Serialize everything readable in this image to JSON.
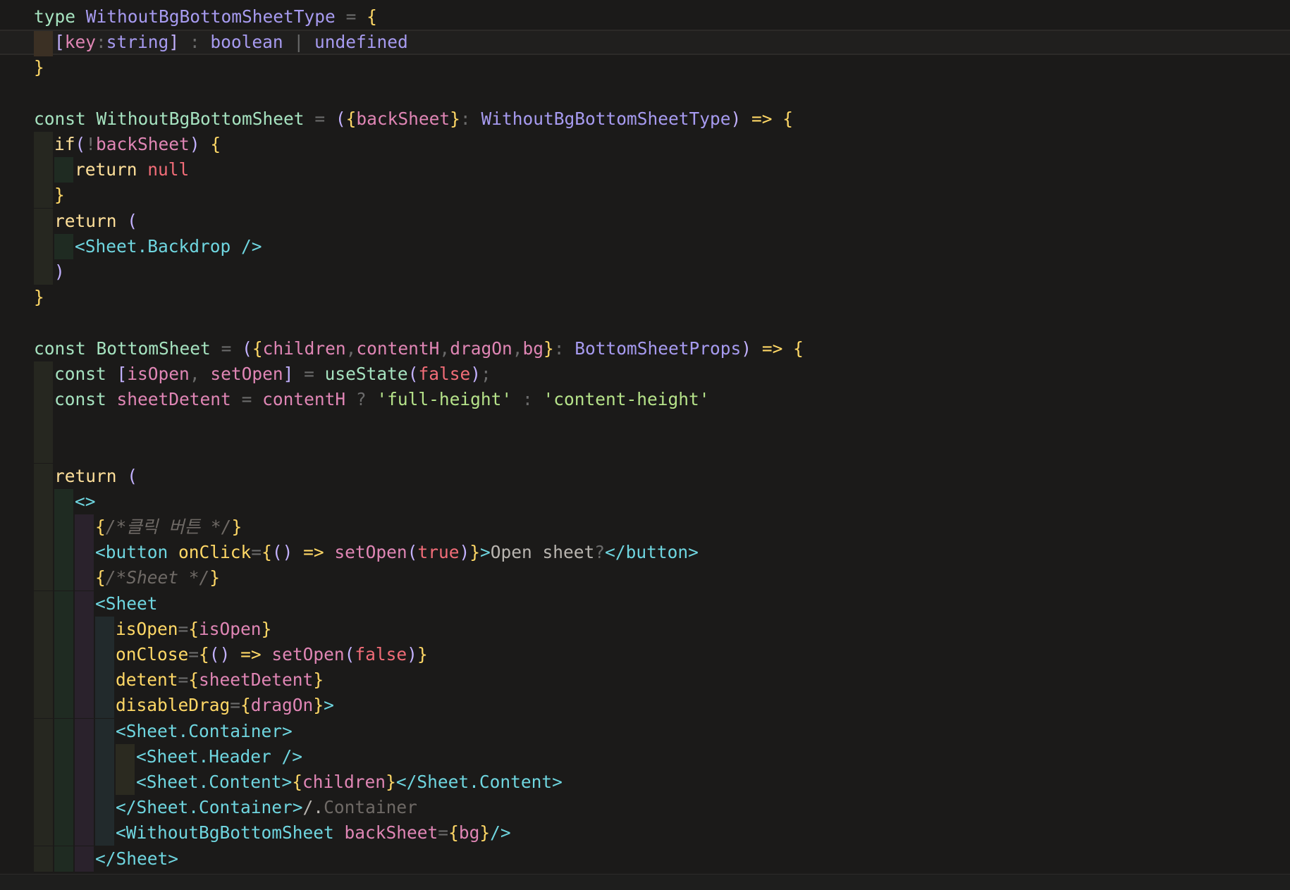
{
  "editor": {
    "lines": [
      {
        "indent": 0,
        "text": "type WithoutBgBottomSheetType = {"
      },
      {
        "indent": 1,
        "text": "[key:string] : boolean | undefined"
      },
      {
        "indent": 0,
        "text": "}"
      },
      {
        "indent": 0,
        "text": ""
      },
      {
        "indent": 0,
        "text": "const WithoutBgBottomSheet = ({backSheet}: WithoutBgBottomSheetType) => {"
      },
      {
        "indent": 1,
        "text": "if(!backSheet) {"
      },
      {
        "indent": 2,
        "text": "return null"
      },
      {
        "indent": 1,
        "text": "}"
      },
      {
        "indent": 1,
        "text": "return ("
      },
      {
        "indent": 2,
        "text": "<Sheet.Backdrop />"
      },
      {
        "indent": 1,
        "text": ")"
      },
      {
        "indent": 0,
        "text": "}"
      },
      {
        "indent": 0,
        "text": ""
      },
      {
        "indent": 0,
        "text": "const BottomSheet = ({children,contentH,dragOn,bg}: BottomSheetProps) => {"
      },
      {
        "indent": 1,
        "text": "const [isOpen, setOpen] = useState(false);"
      },
      {
        "indent": 1,
        "text": "const sheetDetent = contentH ? 'full-height' : 'content-height'"
      },
      {
        "indent": 1,
        "text": ""
      },
      {
        "indent": 1,
        "text": ""
      },
      {
        "indent": 1,
        "text": "return ("
      },
      {
        "indent": 2,
        "text": "<>"
      },
      {
        "indent": 3,
        "text": "{/*클릭 버튼 */}"
      },
      {
        "indent": 3,
        "text": "<button onClick={() => setOpen(true)}>Open sheet?</button>"
      },
      {
        "indent": 3,
        "text": "{/*Sheet */}"
      },
      {
        "indent": 3,
        "text": "<Sheet"
      },
      {
        "indent": 4,
        "text": "isOpen={isOpen}"
      },
      {
        "indent": 4,
        "text": "onClose={() => setOpen(false)}"
      },
      {
        "indent": 4,
        "text": "detent={sheetDetent}"
      },
      {
        "indent": 4,
        "text": "disableDrag={dragOn}>"
      },
      {
        "indent": 4,
        "text": "<Sheet.Container>"
      },
      {
        "indent": 5,
        "text": "<Sheet.Header />"
      },
      {
        "indent": 5,
        "text": "<Sheet.Content>{children}</Sheet.Content>"
      },
      {
        "indent": 4,
        "text": "</Sheet.Container>/.Container"
      },
      {
        "indent": 4,
        "text": "<WithoutBgBottomSheet backSheet={bg}/>"
      },
      {
        "indent": 3,
        "text": "</Sheet>"
      }
    ]
  },
  "colors": {
    "background": "#1b1a19",
    "keyword": "#a6e3c0",
    "type": "#a79bf0",
    "variable": "#e086b5",
    "string": "#b6e38a",
    "tag": "#6fd6e0",
    "attribute": "#ffd866",
    "comment": "#6f6a66",
    "null": "#f26d78"
  }
}
